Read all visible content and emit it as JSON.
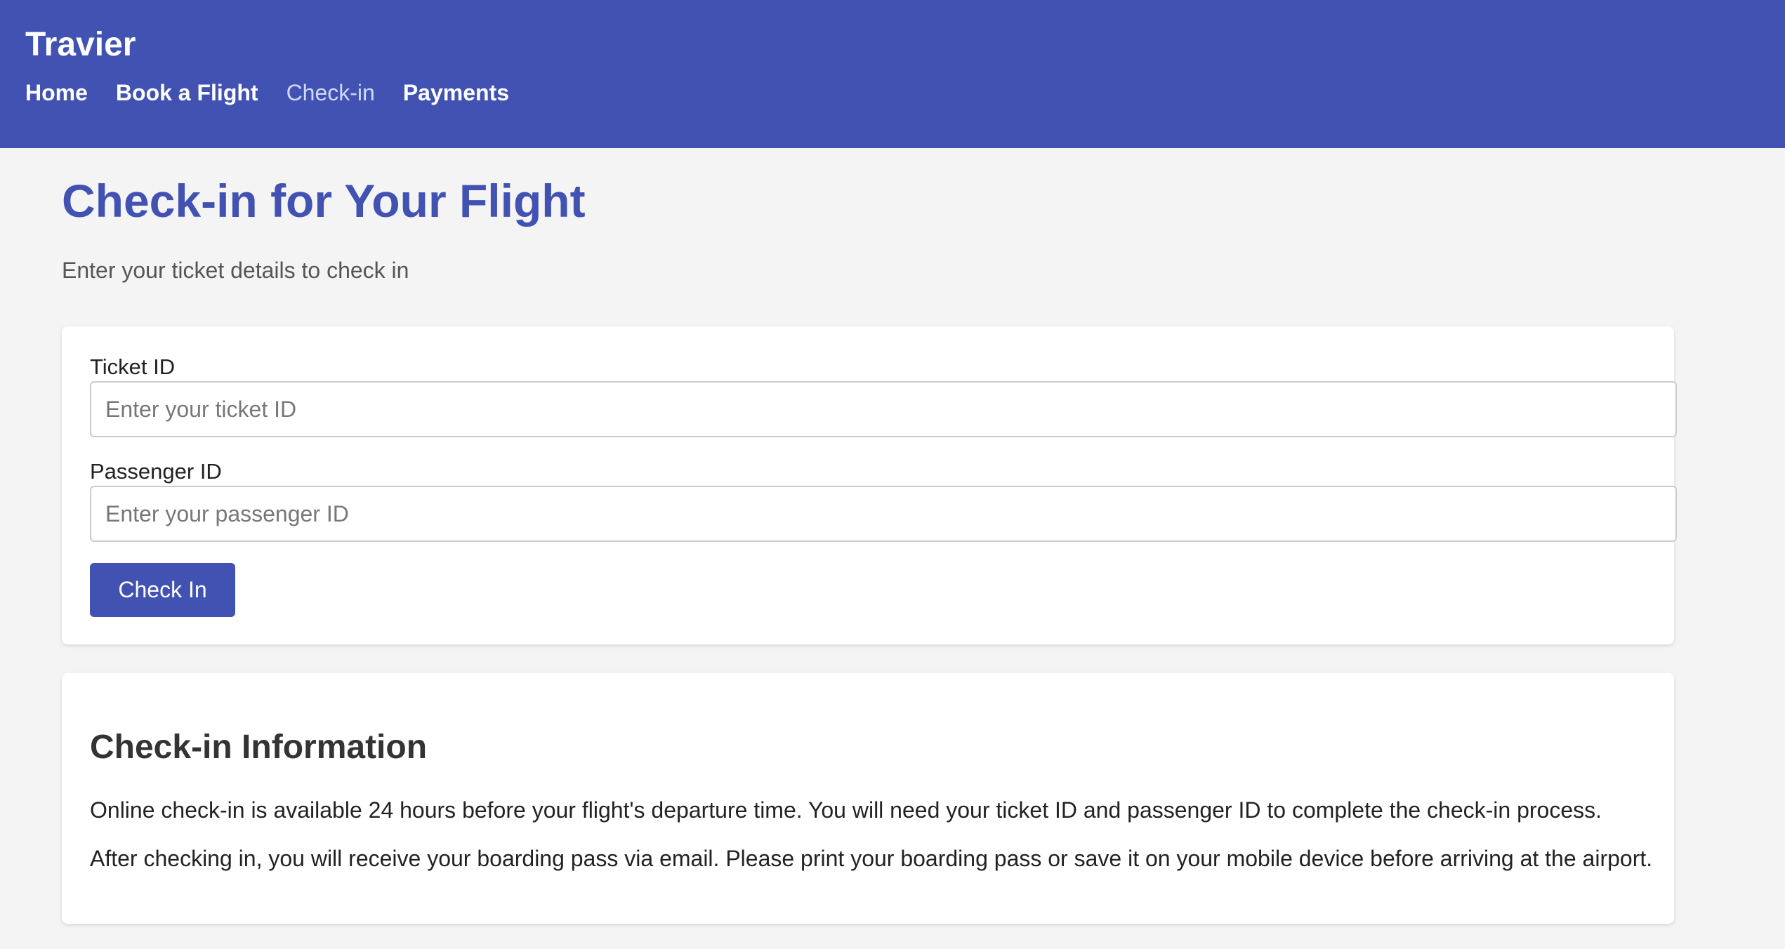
{
  "header": {
    "brand": "Travier",
    "nav": [
      {
        "label": "Home",
        "active": false
      },
      {
        "label": "Book a Flight",
        "active": false
      },
      {
        "label": "Check-in",
        "active": true
      },
      {
        "label": "Payments",
        "active": false
      }
    ]
  },
  "main": {
    "title": "Check-in for Your Flight",
    "subtitle": "Enter your ticket details to check in",
    "form": {
      "ticket_label": "Ticket ID",
      "ticket_placeholder": "Enter your ticket ID",
      "ticket_value": "",
      "passenger_label": "Passenger ID",
      "passenger_placeholder": "Enter your passenger ID",
      "passenger_value": "",
      "submit_label": "Check In"
    },
    "info": {
      "title": "Check-in Information",
      "paragraphs": [
        "Online check-in is available 24 hours before your flight's departure time. You will need your ticket ID and passenger ID to complete the check-in process.",
        "After checking in, you will receive your boarding pass via email. Please print your boarding pass or save it on your mobile device before arriving at the airport."
      ]
    }
  },
  "colors": {
    "primary": "#4152b2",
    "active_nav": "#d0d8fa",
    "background": "#f4f4f4",
    "card": "#ffffff"
  }
}
